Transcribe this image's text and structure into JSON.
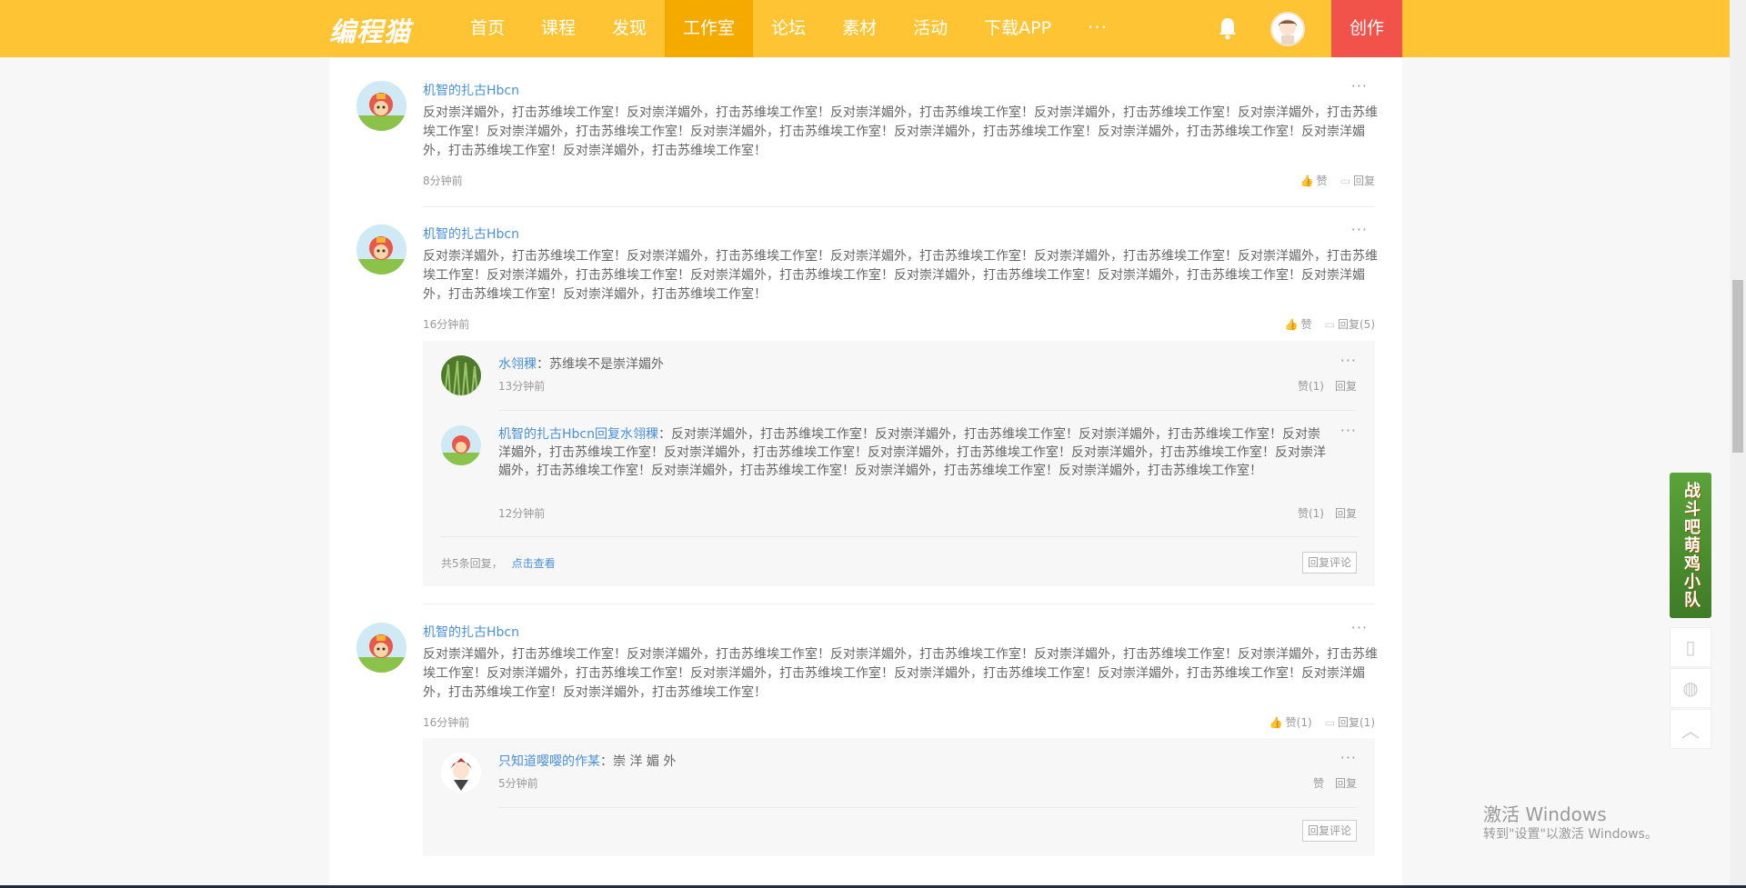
{
  "header": {
    "logo": "编程猫",
    "nav": [
      "首页",
      "课程",
      "发现",
      "工作室",
      "论坛",
      "素材",
      "活动",
      "下载APP"
    ],
    "active_nav": "工作室",
    "more": "···",
    "create": "创作"
  },
  "comments": [
    {
      "author": "机智的扎古Hbcn",
      "text": "反对崇洋媚外，打击苏维埃工作室！反对崇洋媚外，打击苏维埃工作室！反对崇洋媚外，打击苏维埃工作室！反对崇洋媚外，打击苏维埃工作室！反对崇洋媚外，打击苏维埃工作室！反对崇洋媚外，打击苏维埃工作室！反对崇洋媚外，打击苏维埃工作室！反对崇洋媚外，打击苏维埃工作室！反对崇洋媚外，打击苏维埃工作室！反对崇洋媚外，打击苏维埃工作室！反对崇洋媚外，打击苏维埃工作室！",
      "time": "8分钟前",
      "like": "赞",
      "reply": "回复"
    },
    {
      "author": "机智的扎古Hbcn",
      "text": "反对崇洋媚外，打击苏维埃工作室！反对崇洋媚外，打击苏维埃工作室！反对崇洋媚外，打击苏维埃工作室！反对崇洋媚外，打击苏维埃工作室！反对崇洋媚外，打击苏维埃工作室！反对崇洋媚外，打击苏维埃工作室！反对崇洋媚外，打击苏维埃工作室！反对崇洋媚外，打击苏维埃工作室！反对崇洋媚外，打击苏维埃工作室！反对崇洋媚外，打击苏维埃工作室！反对崇洋媚外，打击苏维埃工作室！",
      "time": "16分钟前",
      "like": "赞",
      "reply": "回复(5)",
      "replies": [
        {
          "author": "水翎稞",
          "sep": "：",
          "text": "苏维埃不是崇洋媚外",
          "time": "13分钟前",
          "like": "赞(1)",
          "reply": "回复"
        },
        {
          "author": "机智的扎古Hbcn",
          "reply_word": "回复",
          "reply_to": "水翎稞",
          "sep": "：",
          "text": "反对崇洋媚外，打击苏维埃工作室！反对崇洋媚外，打击苏维埃工作室！反对崇洋媚外，打击苏维埃工作室！反对崇洋媚外，打击苏维埃工作室！反对崇洋媚外，打击苏维埃工作室！反对崇洋媚外，打击苏维埃工作室！反对崇洋媚外，打击苏维埃工作室！反对崇洋媚外，打击苏维埃工作室！反对崇洋媚外，打击苏维埃工作室！反对崇洋媚外，打击苏维埃工作室！反对崇洋媚外，打击苏维埃工作室！",
          "time": "12分钟前",
          "like": "赞(1)",
          "reply": "回复"
        }
      ],
      "replies_total": "共5条回复，",
      "replies_view": "点击查看",
      "reply_comment": "回复评论"
    },
    {
      "author": "机智的扎古Hbcn",
      "text": "反对崇洋媚外，打击苏维埃工作室！反对崇洋媚外，打击苏维埃工作室！反对崇洋媚外，打击苏维埃工作室！反对崇洋媚外，打击苏维埃工作室！反对崇洋媚外，打击苏维埃工作室！反对崇洋媚外，打击苏维埃工作室！反对崇洋媚外，打击苏维埃工作室！反对崇洋媚外，打击苏维埃工作室！反对崇洋媚外，打击苏维埃工作室！反对崇洋媚外，打击苏维埃工作室！反对崇洋媚外，打击苏维埃工作室！",
      "time": "16分钟前",
      "like": "赞(1)",
      "reply": "回复(1)",
      "replies": [
        {
          "author": "只知道嘤嘤的作某",
          "sep": "：",
          "text": "崇 洋 媚 外",
          "time": "5分钟前",
          "like": "赞",
          "reply": "回复"
        }
      ],
      "reply_comment": "回复评论"
    }
  ],
  "side_banner": "战斗吧萌鸡小队",
  "watermark": {
    "line1": "激活 Windows",
    "line2": "转到\"设置\"以激活 Windows。"
  },
  "colors": {
    "header": "#fec433",
    "active_nav": "#f5aa00",
    "create": "#f1534a",
    "link": "#4a90d9"
  }
}
